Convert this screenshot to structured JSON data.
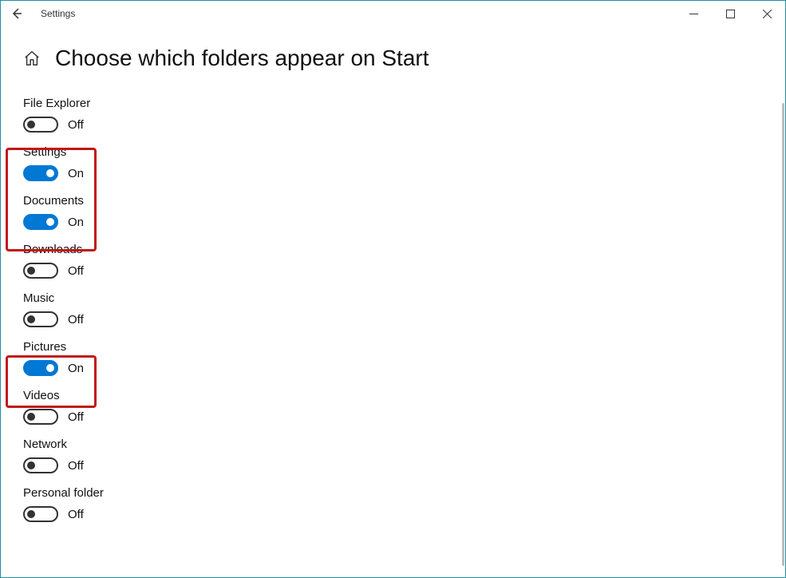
{
  "window": {
    "title": "Settings",
    "colors": {
      "accent": "#0078d4",
      "border": "#1b8fa5",
      "highlight": "#c21717"
    }
  },
  "page": {
    "title": "Choose which folders appear on Start"
  },
  "state_labels": {
    "on": "On",
    "off": "Off"
  },
  "settings": [
    {
      "label": "File Explorer",
      "on": false
    },
    {
      "label": "Settings",
      "on": true
    },
    {
      "label": "Documents",
      "on": true
    },
    {
      "label": "Downloads",
      "on": false
    },
    {
      "label": "Music",
      "on": false
    },
    {
      "label": "Pictures",
      "on": true
    },
    {
      "label": "Videos",
      "on": false
    },
    {
      "label": "Network",
      "on": false
    },
    {
      "label": "Personal folder",
      "on": false
    }
  ],
  "highlights": [
    {
      "covers_indices": [
        1,
        2
      ]
    },
    {
      "covers_indices": [
        5
      ]
    }
  ]
}
